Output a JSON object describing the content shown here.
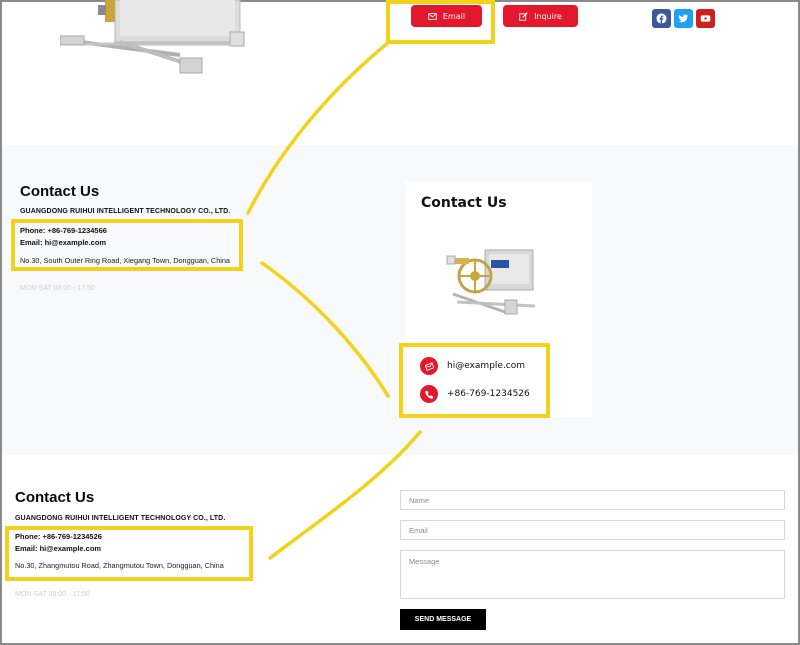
{
  "top": {
    "email_button": "Email",
    "inquire_button": "Inquire"
  },
  "social": {
    "facebook": {
      "icon": "facebook-icon",
      "color": "#3b5998"
    },
    "twitter": {
      "icon": "twitter-icon",
      "color": "#1da1f2"
    },
    "youtube": {
      "icon": "youtube-icon",
      "color": "#cd201f"
    }
  },
  "section1": {
    "title": "Contact Us",
    "company": "GUANGDONG RUIHUI INTELLIGENT TECHNOLOGY CO., LTD.",
    "phone": "Phone: +86-769-1234566",
    "email": "Email: hi@example.com",
    "address": "No.30, South Outer Ring Road, Xiegang Town, Dongguan, China",
    "hours": "MON-SAT 08:00 - 17:50"
  },
  "card": {
    "title": "Contact Us",
    "email": "hi@example.com",
    "phone": "+86-769-1234526"
  },
  "section2": {
    "title": "Contact Us",
    "company": "GUANGDONG RUIHUI INTELLIGENT TECHNOLOGY CO., LTD.",
    "phone": "Phone: +86-769-1234526",
    "email": "Email: hi@example.com",
    "address": "No.30, Zhangmutou Road, Zhangmutou Town, Dongguan, China",
    "hours": "MON-SAT 08:00 - 17:50"
  },
  "form": {
    "name_placeholder": "Name",
    "email_placeholder": "Email",
    "message_placeholder": "Message",
    "send_label": "SEND MESSAGE"
  },
  "colors": {
    "accent": "#e3182d",
    "highlight": "#f3d21c",
    "band": "#f7f9fb"
  }
}
